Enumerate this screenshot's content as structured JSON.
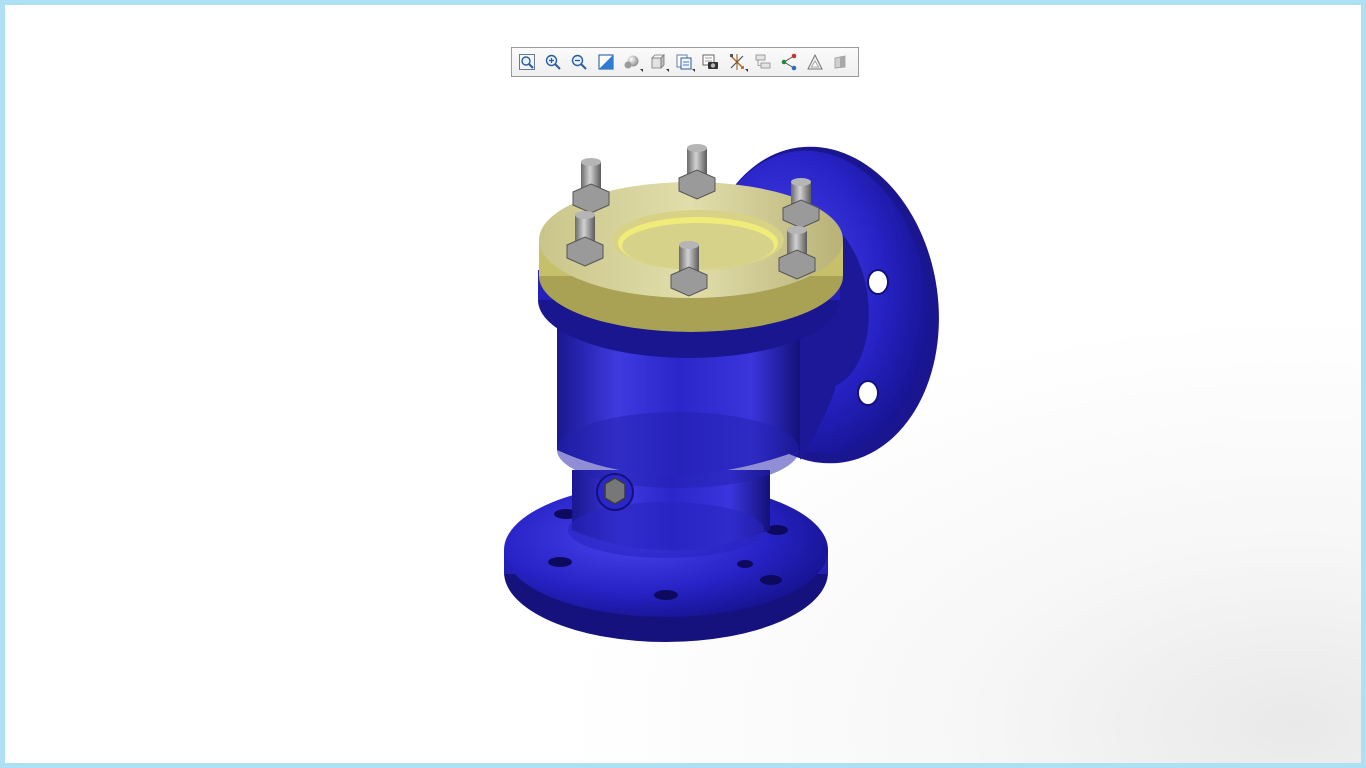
{
  "viewer": {
    "toolbar": {
      "buttons": [
        {
          "id": "zoom-to-fit",
          "icon": "zoom-fit-icon",
          "has_submenu": false
        },
        {
          "id": "zoom-in",
          "icon": "zoom-in-icon",
          "has_submenu": false
        },
        {
          "id": "zoom-out",
          "icon": "zoom-out-icon",
          "has_submenu": false
        },
        {
          "id": "zoom-window",
          "icon": "zoom-window-icon",
          "has_submenu": false
        },
        {
          "id": "display-style",
          "icon": "shaded-style-icon",
          "has_submenu": true
        },
        {
          "id": "view-orientation",
          "icon": "view-cube-icon",
          "has_submenu": true
        },
        {
          "id": "saved-views",
          "icon": "saved-views-icon",
          "has_submenu": true
        },
        {
          "id": "snapshot",
          "icon": "camera-snapshot-icon",
          "has_submenu": false
        },
        {
          "id": "explode",
          "icon": "explode-icon",
          "has_submenu": true
        },
        {
          "id": "model-tree",
          "icon": "model-tree-icon",
          "has_submenu": false
        },
        {
          "id": "connections",
          "icon": "connection-nodes-icon",
          "has_submenu": false
        },
        {
          "id": "measure",
          "icon": "measure-triangle-icon",
          "has_submenu": false
        },
        {
          "id": "section",
          "icon": "section-plane-icon",
          "has_submenu": false
        }
      ]
    },
    "model": {
      "icon": "valve-3d-model",
      "colors": {
        "body": "#2a26c9",
        "body_dark": "#1b1790",
        "cover": "#d8d49a",
        "cover_edge": "#bcb45a",
        "bolt": "#8f8f8f"
      }
    },
    "frame_color": "#aedff3"
  }
}
